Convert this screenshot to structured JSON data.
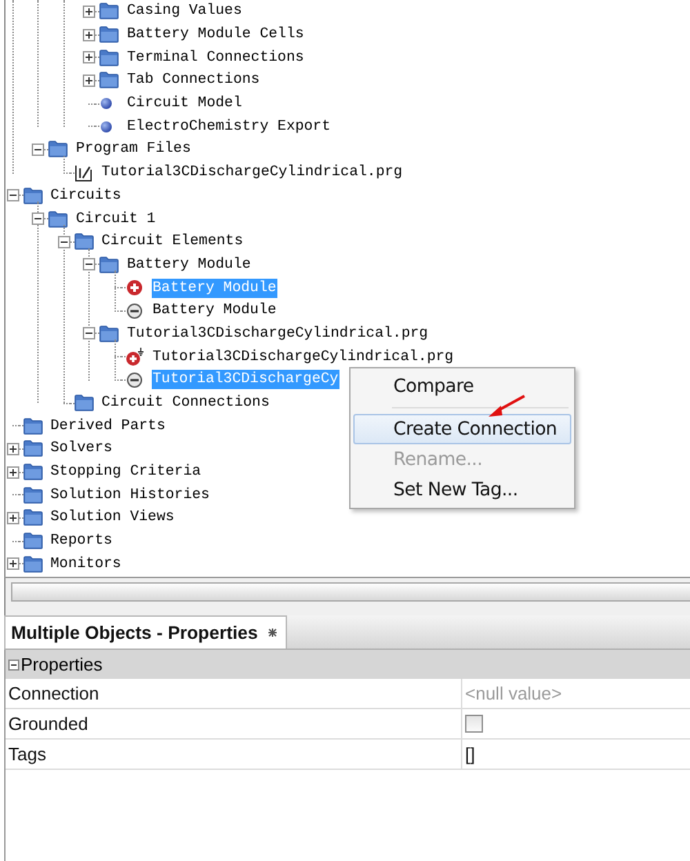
{
  "tree": [
    {
      "kind": "offscreen",
      "children": [
        {
          "kind": "offscreen",
          "children": [
            {
              "kind": "offscreen",
              "children": [
                {
                  "label": "Casing Values",
                  "kind": "folder",
                  "expanded": false,
                  "selected": false
                },
                {
                  "label": "Battery Module Cells",
                  "kind": "folder",
                  "expanded": false,
                  "selected": false
                },
                {
                  "label": "Terminal Connections",
                  "kind": "folder",
                  "expanded": false,
                  "selected": false
                },
                {
                  "label": "Tab Connections",
                  "kind": "folder",
                  "expanded": false,
                  "selected": false
                },
                {
                  "label": "Circuit Model",
                  "kind": "dot",
                  "selected": false
                },
                {
                  "label": "ElectroChemistry Export",
                  "kind": "dot",
                  "selected": false
                }
              ]
            }
          ]
        },
        {
          "label": "Program Files",
          "kind": "folder",
          "expanded": true,
          "selected": false,
          "children": [
            {
              "label": "Tutorial3CDischargeCylindrical.prg",
              "kind": "program",
              "selected": false
            }
          ]
        }
      ]
    },
    {
      "label": "Circuits",
      "kind": "folder",
      "expanded": true,
      "selected": false,
      "children": [
        {
          "label": "Circuit 1",
          "kind": "folder",
          "expanded": true,
          "selected": false,
          "children": [
            {
              "label": "Circuit Elements",
              "kind": "folder",
              "expanded": true,
              "selected": false,
              "children": [
                {
                  "label": "Battery Module",
                  "kind": "folder",
                  "expanded": true,
                  "selected": false,
                  "children": [
                    {
                      "label": "Battery Module",
                      "kind": "positive",
                      "selected": true
                    },
                    {
                      "label": "Battery Module",
                      "kind": "negative",
                      "selected": false
                    }
                  ]
                },
                {
                  "label": "Tutorial3CDischargeCylindrical.prg",
                  "kind": "folder",
                  "expanded": true,
                  "selected": false,
                  "children": [
                    {
                      "label": "Tutorial3CDischargeCylindrical.prg",
                      "kind": "grounded",
                      "selected": false
                    },
                    {
                      "label": "Tutorial3CDischargeCy",
                      "kind": "negative",
                      "selected": true
                    }
                  ]
                }
              ]
            },
            {
              "label": "Circuit Connections",
              "kind": "folder",
              "selected": false
            }
          ]
        }
      ]
    },
    {
      "label": "Derived Parts",
      "kind": "folder",
      "selected": false
    },
    {
      "label": "Solvers",
      "kind": "folder",
      "expanded": false,
      "selected": false
    },
    {
      "label": "Stopping Criteria",
      "kind": "folder",
      "expanded": false,
      "selected": false
    },
    {
      "label": "Solution Histories",
      "kind": "folder",
      "selected": false
    },
    {
      "label": "Solution Views",
      "kind": "folder",
      "expanded": false,
      "selected": false
    },
    {
      "label": "Reports",
      "kind": "folder",
      "selected": false
    },
    {
      "label": "Monitors",
      "kind": "folder",
      "expanded": false,
      "selected": false
    }
  ],
  "context_menu": {
    "items": [
      {
        "label": "Compare",
        "disabled": false,
        "selected": false
      },
      {
        "label": "Create Connection",
        "disabled": false,
        "selected": true
      },
      {
        "label": "Rename...",
        "disabled": true,
        "selected": false
      },
      {
        "label": "Set New Tag...",
        "disabled": false,
        "selected": false
      }
    ]
  },
  "properties": {
    "tab": {
      "title": "Multiple Objects - Properties"
    },
    "section": {
      "title": "Properties",
      "expanded": true
    },
    "rows": [
      {
        "name": "Connection",
        "kind": "text",
        "value": "<null value>",
        "muted": true
      },
      {
        "name": "Grounded",
        "kind": "checkbox",
        "checked": false
      },
      {
        "name": "Tags",
        "kind": "text",
        "value": "[]",
        "muted": false
      }
    ]
  }
}
